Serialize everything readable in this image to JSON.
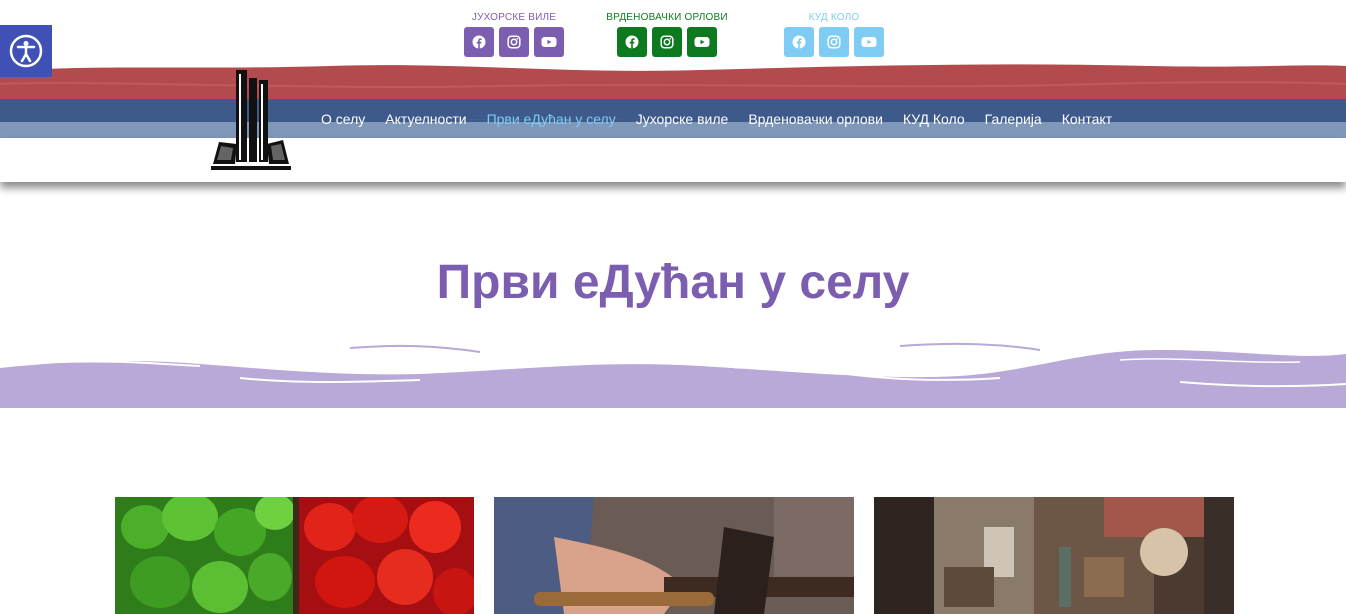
{
  "accessibility": {
    "icon": "accessibility-icon"
  },
  "social_groups": [
    {
      "title": "ЈУХОРСКЕ ВИЛЕ",
      "color": "#7c5eb0",
      "icons": [
        "facebook-icon",
        "instagram-icon",
        "youtube-icon"
      ]
    },
    {
      "title": "ВРДЕНОВАЧКИ ОРЛОВИ",
      "color": "#0e7a1f",
      "icons": [
        "facebook-icon",
        "instagram-icon",
        "youtube-icon"
      ]
    },
    {
      "title": "КУД КОЛО",
      "color": "#7ecbf4",
      "icons": [
        "facebook-icon",
        "instagram-icon",
        "youtube-icon"
      ]
    }
  ],
  "nav": {
    "items": [
      {
        "label": "О селу"
      },
      {
        "label": "Актуелности"
      },
      {
        "label": "Први еДућан у селу",
        "active": true
      },
      {
        "label": "Јухорске виле"
      },
      {
        "label": "Врденовачки орлови"
      },
      {
        "label": "КУД Коло"
      },
      {
        "label": "Галерија"
      },
      {
        "label": "Контакт"
      }
    ]
  },
  "colors": {
    "red_band": "#b34a4e",
    "blue_band": "#3d5a8a",
    "light_blue_band": "#7f97b8",
    "wave": "#b8a9d8",
    "title": "#7c5eb0"
  },
  "page": {
    "title": "Први еДућан у селу"
  },
  "cards": [
    {
      "name": "peppers-image"
    },
    {
      "name": "hammer-image"
    },
    {
      "name": "workshop-image"
    }
  ]
}
